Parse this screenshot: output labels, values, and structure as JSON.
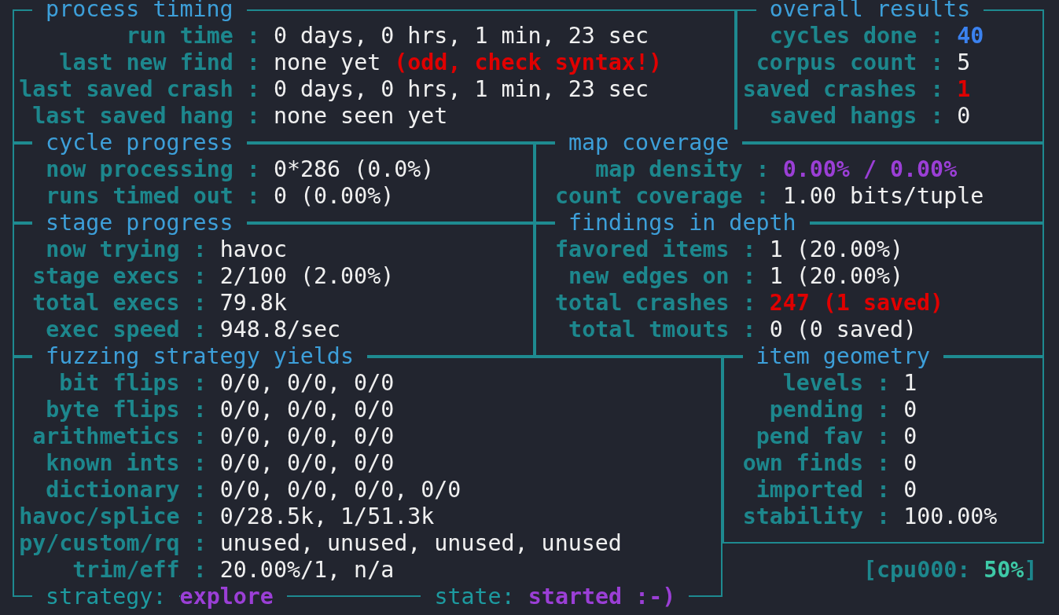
{
  "process_timing": {
    "title": "process timing",
    "rows": [
      {
        "label": "run time :",
        "value": "0 days, 0 hrs, 1 min, 23 sec",
        "kind": "normal"
      },
      {
        "label": "last new find :",
        "value": "none yet",
        "kind": "normal",
        "note": "(odd, check syntax!)"
      },
      {
        "label": "last saved crash :",
        "value": "0 days, 0 hrs, 1 min, 23 sec",
        "kind": "normal"
      },
      {
        "label": "last saved hang :",
        "value": "none seen yet",
        "kind": "normal"
      }
    ]
  },
  "overall_results": {
    "title": "overall results",
    "rows": [
      {
        "label": "cycles done :",
        "value": "40",
        "kind": "highlight"
      },
      {
        "label": "corpus count :",
        "value": "5",
        "kind": "normal"
      },
      {
        "label": "saved crashes :",
        "value": "1",
        "kind": "alert"
      },
      {
        "label": "saved hangs :",
        "value": "0",
        "kind": "normal"
      }
    ]
  },
  "cycle_progress": {
    "title": "cycle progress",
    "rows": [
      {
        "label": "now processing :",
        "value": "0*286 (0.0%)",
        "kind": "normal"
      },
      {
        "label": "runs timed out :",
        "value": "0 (0.00%)",
        "kind": "normal"
      }
    ]
  },
  "map_coverage": {
    "title": "map coverage",
    "rows": [
      {
        "label": "map density :",
        "value": "0.00% / 0.00%",
        "kind": "accent"
      },
      {
        "label": "count coverage :",
        "value": "1.00 bits/tuple",
        "kind": "normal"
      }
    ]
  },
  "stage_progress": {
    "title": "stage progress",
    "rows": [
      {
        "label": "now trying :",
        "value": "havoc",
        "kind": "normal"
      },
      {
        "label": "stage execs :",
        "value": "2/100 (2.00%)",
        "kind": "normal"
      },
      {
        "label": "total execs :",
        "value": "79.8k",
        "kind": "normal"
      },
      {
        "label": "exec speed :",
        "value": "948.8/sec",
        "kind": "normal"
      }
    ]
  },
  "findings_in_depth": {
    "title": "findings in depth",
    "rows": [
      {
        "label": "favored items :",
        "value": "1 (20.00%)",
        "kind": "normal"
      },
      {
        "label": "new edges on :",
        "value": "1 (20.00%)",
        "kind": "normal"
      },
      {
        "label": "total crashes :",
        "value": "247 (1 saved)",
        "kind": "alert"
      },
      {
        "label": "total tmouts :",
        "value": "0 (0 saved)",
        "kind": "normal"
      }
    ]
  },
  "fuzzing_strategy_yields": {
    "title": "fuzzing strategy yields",
    "rows": [
      {
        "label": "bit flips :",
        "value": "0/0, 0/0, 0/0",
        "kind": "normal"
      },
      {
        "label": "byte flips :",
        "value": "0/0, 0/0, 0/0",
        "kind": "normal"
      },
      {
        "label": "arithmetics :",
        "value": "0/0, 0/0, 0/0",
        "kind": "normal"
      },
      {
        "label": "known ints :",
        "value": "0/0, 0/0, 0/0",
        "kind": "normal"
      },
      {
        "label": "dictionary :",
        "value": "0/0, 0/0, 0/0, 0/0",
        "kind": "normal"
      },
      {
        "label": "havoc/splice :",
        "value": "0/28.5k, 1/51.3k",
        "kind": "normal"
      },
      {
        "label": "py/custom/rq :",
        "value": "unused, unused, unused, unused",
        "kind": "normal"
      },
      {
        "label": "trim/eff :",
        "value": "20.00%/1, n/a",
        "kind": "normal"
      }
    ],
    "strategy": {
      "label": "strategy:",
      "value": "explore"
    },
    "state": {
      "label": "state:",
      "value": "started :-)"
    }
  },
  "item_geometry": {
    "title": "item geometry",
    "rows": [
      {
        "label": "levels :",
        "value": "1",
        "kind": "normal"
      },
      {
        "label": "pending :",
        "value": "0",
        "kind": "normal"
      },
      {
        "label": "pend fav :",
        "value": "0",
        "kind": "normal"
      },
      {
        "label": "own finds :",
        "value": "0",
        "kind": "normal"
      },
      {
        "label": "imported :",
        "value": "0",
        "kind": "normal"
      },
      {
        "label": "stability :",
        "value": "100.00%",
        "kind": "normal"
      }
    ]
  },
  "cpu": {
    "label": "[cpu000:",
    "value": "50%",
    "suffix": "]"
  }
}
